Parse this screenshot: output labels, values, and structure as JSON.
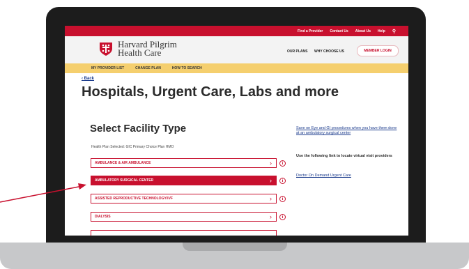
{
  "topbar": {
    "links": [
      "Find a Provider",
      "Contact Us",
      "About Us",
      "Help"
    ]
  },
  "header": {
    "logo_line1": "Harvard Pilgrim",
    "logo_line2": "Health Care",
    "nav": [
      "OUR PLANS",
      "WHY CHOOSE US"
    ],
    "member_login": "MEMBER LOGIN"
  },
  "subnav": [
    "MY PROVIDER LIST",
    "CHANGE PLAN",
    "HOW TO SEARCH"
  ],
  "main": {
    "back": "Back",
    "title": "Hospitals, Urgent Care, Labs and more",
    "section_title": "Select Facility Type",
    "plan_selected": "Health Plan Selected: GIC Primary Choice Plan HMO",
    "facilities": [
      {
        "label": "AMBULANCE & AIR AMBULANCE",
        "selected": false
      },
      {
        "label": "AMBULATORY SURGICAL CENTER",
        "selected": true
      },
      {
        "label": "ASSISTED REPRODUCTIVE TECHNOLOGY/IVF",
        "selected": false
      },
      {
        "label": "DIALYSIS",
        "selected": false
      }
    ]
  },
  "sidebar": {
    "promo_link": "Save on Eye and GI procedures when you have them done at an ambulatory surgical center",
    "virtual_text": "Use the following link to locate virtual visit providers",
    "doctor_link": "Doctor On Demand Urgent Care"
  },
  "colors": {
    "brand_red": "#c8102e",
    "subnav_yellow": "#f5cf6e",
    "link_blue": "#1a3a8c"
  }
}
